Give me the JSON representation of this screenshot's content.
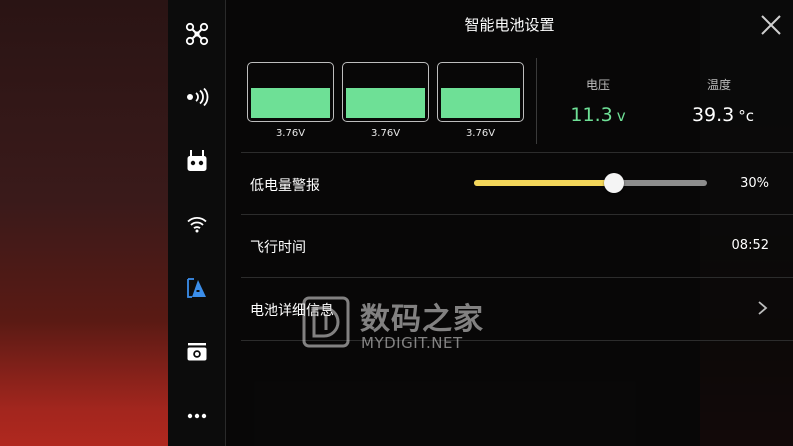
{
  "header": {
    "title": "智能电池设置"
  },
  "battery": {
    "cells": [
      {
        "voltage": "3.76V",
        "level": 0.58
      },
      {
        "voltage": "3.76V",
        "level": 0.58
      },
      {
        "voltage": "3.76V",
        "level": 0.58
      }
    ],
    "voltage": {
      "label": "电压",
      "value": "11.3",
      "unit": "v",
      "color": "#6ee096"
    },
    "temperature": {
      "label": "温度",
      "value": "39.3",
      "unit": "°c",
      "color": "#ffffff"
    }
  },
  "low_battery_warning": {
    "label": "低电量警报",
    "value": "30%",
    "percent": 30
  },
  "flight_time": {
    "label": "飞行时间",
    "value": "08:52"
  },
  "battery_details": {
    "label": "电池详细信息"
  },
  "sidebar": {
    "items": [
      {
        "name": "aircraft-icon"
      },
      {
        "name": "signal-icon"
      },
      {
        "name": "remote-controller-icon"
      },
      {
        "name": "wifi-icon"
      },
      {
        "name": "battery-settings-icon",
        "active": true,
        "color": "#3b8eea"
      },
      {
        "name": "camera-icon"
      },
      {
        "name": "more-icon"
      }
    ]
  },
  "watermark": {
    "cn": "数码之家",
    "en": "MYDIGIT.NET"
  },
  "colors": {
    "accent_green": "#6ee096",
    "slider_yellow": "#f3d65a",
    "active_blue": "#3b8eea"
  }
}
